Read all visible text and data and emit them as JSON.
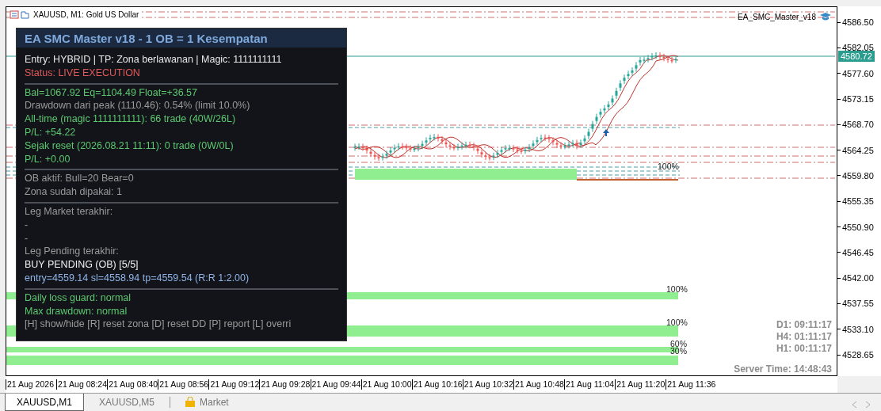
{
  "chart": {
    "symbol": "XAUUSD, M1:  Gold US Dollar",
    "expert": "EA_SMC_Master_v18",
    "current_price": "4580.72",
    "price_axis": [
      "4586.50",
      "4582.05",
      "4577.60",
      "4573.15",
      "4568.70",
      "4564.25",
      "4559.80",
      "4555.35",
      "4550.90",
      "4546.45",
      "4542.00",
      "4537.55",
      "4533.10",
      "4528.65"
    ],
    "time_axis": [
      "21 Aug 2026",
      "21 Aug 08:24",
      "21 Aug 08:40",
      "21 Aug 08:56",
      "21 Aug 09:12",
      "21 Aug 09:28",
      "21 Aug 09:44",
      "21 Aug 10:00",
      "21 Aug 10:16",
      "21 Aug 10:32",
      "21 Aug 10:48",
      "21 Aug 11:04",
      "21 Aug 11:20",
      "21 Aug 11:36"
    ],
    "zone_labels": [
      "100%",
      "100%",
      "100%",
      "60%",
      "30%"
    ],
    "timers": [
      "D1: 09:11:17",
      "H4: 01:11:17",
      "H1: 00:11:17"
    ],
    "server_time": "Server Time: 14:48:43"
  },
  "panel": {
    "title": "EA SMC Master v18  -  1 OB = 1 Kesempatan",
    "sections": [
      [
        {
          "text": "Entry: HYBRID  |  TP: Zona berlawanan  |  Magic: 1111111111",
          "color": "#e8e8e8"
        },
        {
          "text": "Status: LIVE EXECUTION",
          "color": "#e05a5a"
        }
      ],
      [
        {
          "text": "Bal=1067.92  Eq=1104.49  Float=+36.57",
          "color": "#5cc870"
        },
        {
          "text": "Drawdown dari peak (1110.46): 0.54%  (limit 10.0%)",
          "color": "#9a9a9a"
        },
        {
          "text": "All-time (magic 1111111111): 66 trade (40W/26L)",
          "color": "#5cc870"
        },
        {
          "text": "P/L: +54.22",
          "color": "#5cc870"
        },
        {
          "text": "Sejak reset (2026.08.21 11:11): 0 trade (0W/0L)",
          "color": "#5cc870"
        },
        {
          "text": "P/L: +0.00",
          "color": "#5cc870"
        }
      ],
      [
        {
          "text": "OB aktif: Bull=20  Bear=0",
          "color": "#9a9a9a"
        },
        {
          "text": "Zona sudah dipakai: 1",
          "color": "#9a9a9a"
        }
      ],
      [
        {
          "text": "Leg Market terakhir:",
          "color": "#9a9a9a"
        },
        {
          "text": "-"
        },
        {
          "text": "-"
        },
        {
          "text": "Leg Pending terakhir:",
          "color": "#9a9a9a"
        },
        {
          "text": "BUY PENDING (OB) [5/5]",
          "color": "#f0f0f0"
        },
        {
          "text": "entry=4559.14  sl=4558.94  tp=4559.54  (R:R 1:2.00)",
          "color": "#8fb4e8"
        }
      ],
      [
        {
          "text": "Daily loss guard: normal",
          "color": "#5cc870"
        },
        {
          "text": "Max drawdown: normal",
          "color": "#5cc870"
        },
        {
          "text": "[H] show/hide [R] reset zona [D] reset DD [P] report [L] overri",
          "color": "#9a9a9a"
        }
      ]
    ]
  },
  "tabs": [
    {
      "label": "XAUUSD,M1",
      "selected": true,
      "kind": "chart"
    },
    {
      "label": "XAUUSD,M5",
      "selected": false,
      "kind": "chart"
    },
    {
      "label": "Market",
      "selected": false,
      "kind": "market"
    }
  ]
}
